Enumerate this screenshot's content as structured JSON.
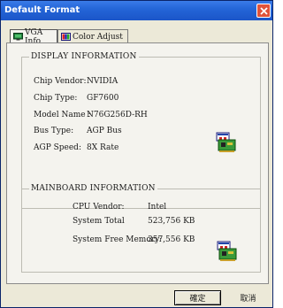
{
  "window": {
    "title": "Default Format"
  },
  "tabs": [
    {
      "label": "VGA Info",
      "icon": "monitor-icon",
      "active": true
    },
    {
      "label": "Color Adjust",
      "icon": "color-chart-icon",
      "active": false
    }
  ],
  "display": {
    "heading": "DISPLAY INFORMATION",
    "fields": [
      {
        "label": "Chip Vendor:",
        "value": "NVIDIA"
      },
      {
        "label": "Chip Type:",
        "value": "GF7600"
      },
      {
        "label": "Model Name :",
        "value": "N76G256D-RH"
      },
      {
        "label": "Bus Type:",
        "value": "AGP Bus"
      },
      {
        "label": "AGP Speed:",
        "value": "8X Rate"
      }
    ],
    "icon": "pci-card-icon"
  },
  "mainboard": {
    "heading": "MAINBOARD INFORMATION",
    "fields": [
      {
        "label": "CPU Vendor:",
        "value": "Intel"
      },
      {
        "label": "System Total",
        "value": "523,756 KB"
      },
      {
        "label": "System Free Memory:",
        "value": "357,556 KB"
      }
    ],
    "icon": "pci-card-icon"
  },
  "buttons": {
    "ok": "確定",
    "cancel": "取消"
  }
}
